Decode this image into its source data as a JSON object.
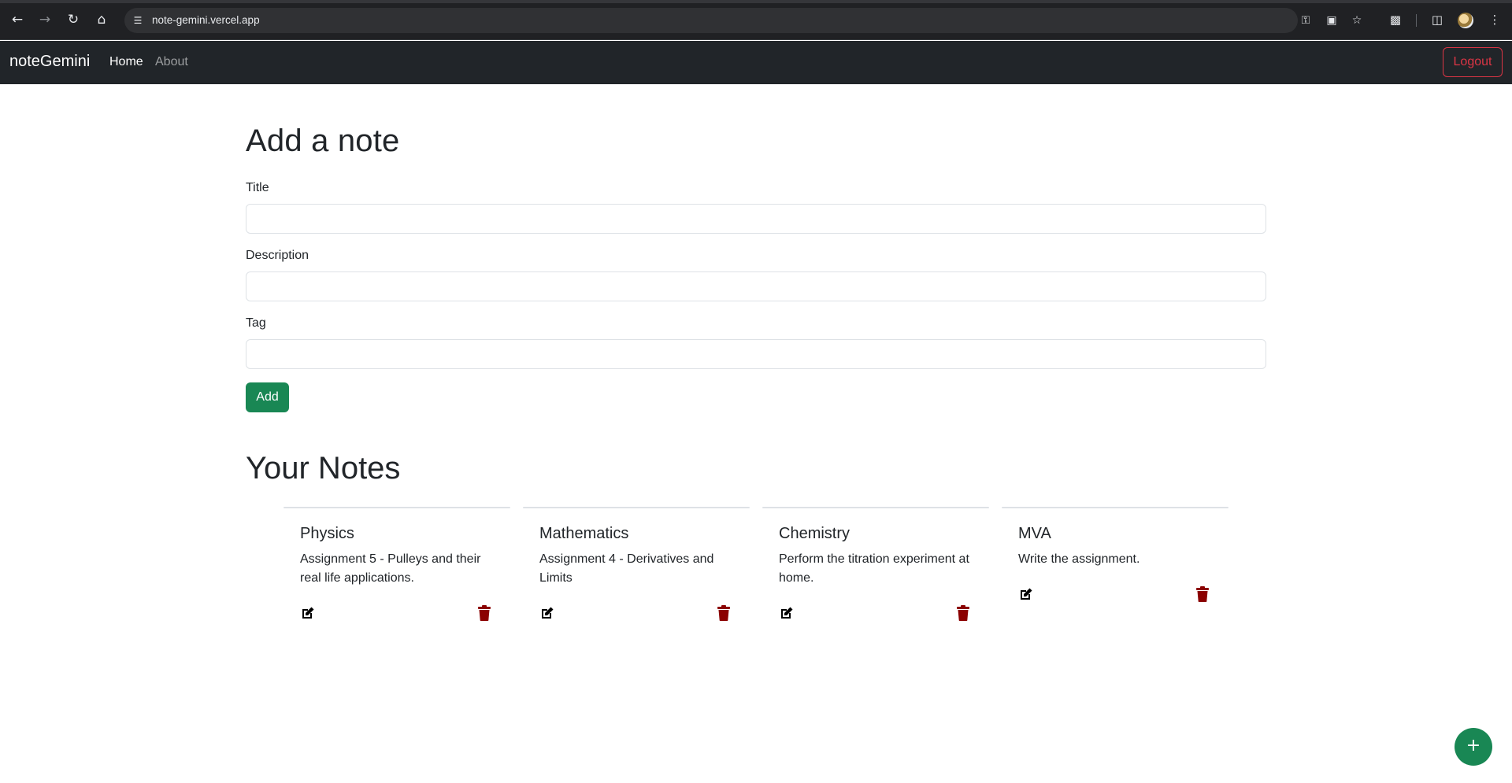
{
  "browser": {
    "url": "note-gemini.vercel.app",
    "icons": {
      "back": "back-arrow-icon",
      "forward": "forward-arrow-icon",
      "reload": "reload-icon",
      "home": "home-icon",
      "site_info": "tune-icon",
      "password": "key-icon",
      "install": "install-app-icon",
      "bookmark": "star-icon",
      "extensions": "puzzle-icon",
      "side_panel": "side-panel-icon",
      "profile": "avatar",
      "menu": "kebab-menu-icon"
    }
  },
  "navbar": {
    "brand": "noteGemini",
    "links": [
      {
        "label": "Home",
        "active": true
      },
      {
        "label": "About",
        "active": false
      }
    ],
    "logout_label": "Logout"
  },
  "form": {
    "heading": "Add a note",
    "fields": [
      {
        "label": "Title",
        "value": ""
      },
      {
        "label": "Description",
        "value": ""
      },
      {
        "label": "Tag",
        "value": ""
      }
    ],
    "submit_label": "Add"
  },
  "notes": {
    "heading": "Your Notes",
    "items": [
      {
        "title": "Physics",
        "description": "Assignment 5 - Pulleys and their real life applications."
      },
      {
        "title": "Mathematics",
        "description": "Assignment 4 - Derivatives and Limits"
      },
      {
        "title": "Chemistry",
        "description": "Perform the titration experiment at home."
      },
      {
        "title": "MVA",
        "description": "Write the assignment."
      }
    ]
  },
  "fab_label": "+",
  "colors": {
    "navbar_bg": "#212529",
    "success": "#198754",
    "danger": "#dc3545",
    "trash": "#8b0000"
  }
}
